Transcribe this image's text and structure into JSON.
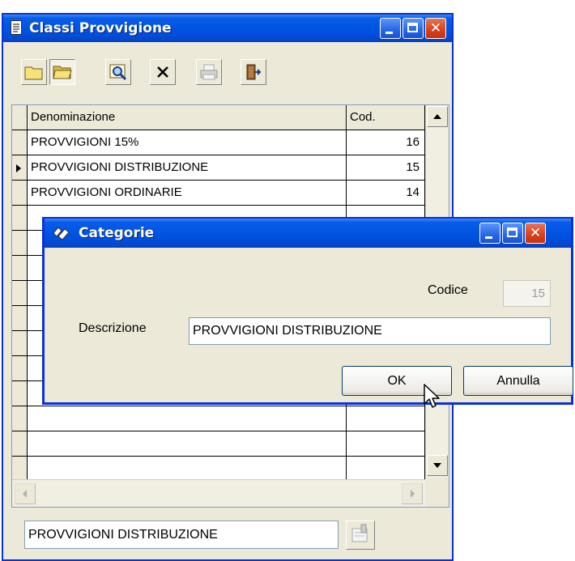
{
  "main_window": {
    "title": "Classi Provvigione",
    "toolbar": [
      {
        "name": "new-icon"
      },
      {
        "name": "open-icon"
      },
      {
        "name": "search-icon"
      },
      {
        "name": "delete-icon"
      },
      {
        "name": "print-icon"
      },
      {
        "name": "exit-icon"
      }
    ],
    "grid": {
      "columns": [
        "Denominazione",
        "Cod."
      ],
      "rows": [
        {
          "denominazione": "PROVVIGIONI 15%",
          "cod": "16"
        },
        {
          "denominazione": "PROVVIGIONI DISTRIBUZIONE",
          "cod": "15",
          "current": true
        },
        {
          "denominazione": "PROVVIGIONI ORDINARIE",
          "cod": "14"
        }
      ]
    },
    "bottom_field": "PROVVIGIONI DISTRIBUZIONE"
  },
  "dialog": {
    "title": "Categorie",
    "codice_label": "Codice",
    "codice_value": "15",
    "descrizione_label": "Descrizione",
    "descrizione_value": "PROVVIGIONI DISTRIBUZIONE",
    "ok_label": "OK",
    "cancel_label": "Annulla"
  },
  "colors": {
    "titlebar": "#0054e3",
    "window_face": "#ece9d8",
    "close_button": "#d8401c"
  }
}
